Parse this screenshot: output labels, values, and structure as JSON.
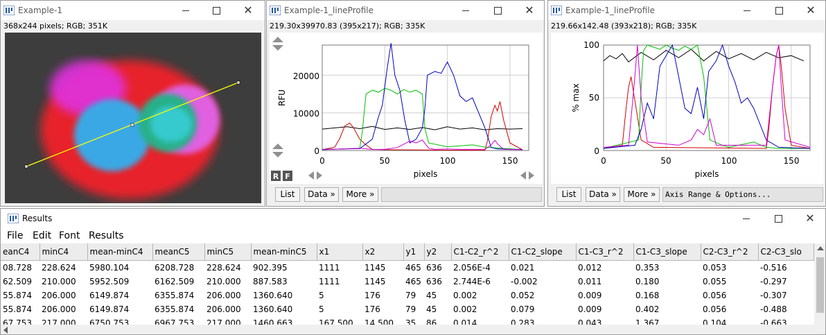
{
  "image_window": {
    "title": "Example-1",
    "info": "368x244 pixels; RGB; 351K"
  },
  "profile1": {
    "title": "Example-1_lineProfile",
    "info": "219.30x39970.83  (395x217); RGB; 335K",
    "ylabel": "RFU",
    "xlabel": "pixels",
    "y_ticks": [
      "0",
      "10000",
      "20000"
    ],
    "x_ticks": [
      "0",
      "50",
      "100",
      "150"
    ],
    "rf_r": "R",
    "rf_f": "F",
    "buttons": {
      "list": "List",
      "data": "Data »",
      "more": "More »"
    }
  },
  "profile2": {
    "title": "Example-1_lineProfile",
    "info": "219.66x142.48  (393x218); RGB; 335K",
    "ylabel": "% max",
    "xlabel": "pixels",
    "y_ticks": [
      "0",
      "50",
      "100"
    ],
    "x_ticks": [
      "0",
      "50",
      "100",
      "150"
    ],
    "buttons": {
      "list": "List",
      "data": "Data »",
      "more": "More »"
    },
    "status": "Axis Range & Options..."
  },
  "results": {
    "title": "Results",
    "menu": [
      "File",
      "Edit",
      "Font",
      "Results"
    ],
    "columns": [
      "eanC4",
      "minC4",
      "mean-minC4",
      "meanC5",
      "minC5",
      "mean-minC5",
      "x1",
      "x2",
      "y1",
      "y2",
      "C1-C2_r^2",
      "C1-C2_slope",
      "C1-C3_r^2",
      "C1-C3_slope",
      "C2-C3_r^2",
      "C2-C3_slo"
    ],
    "rows": [
      [
        "08.728",
        "228.624",
        "5980.104",
        "6208.728",
        "228.624",
        "902.395",
        "1111",
        "1145",
        "465",
        "636",
        "2.056E-4",
        "0.021",
        "0.012",
        "0.353",
        "0.053",
        "-0.516"
      ],
      [
        "62.509",
        "210.000",
        "5952.509",
        "6162.509",
        "210.000",
        "887.583",
        "1111",
        "1145",
        "465",
        "636",
        "2.744E-6",
        "-0.002",
        "0.011",
        "0.180",
        "0.055",
        "-0.297"
      ],
      [
        "55.874",
        "206.000",
        "6149.874",
        "6355.874",
        "206.000",
        "1360.640",
        "5",
        "176",
        "79",
        "45",
        "0.002",
        "0.052",
        "0.009",
        "0.168",
        "0.056",
        "-0.307"
      ],
      [
        "55.874",
        "206.000",
        "6149.874",
        "6355.874",
        "206.000",
        "1360.640",
        "5",
        "176",
        "79",
        "45",
        "0.002",
        "0.079",
        "0.009",
        "0.402",
        "0.056",
        "-0.488"
      ],
      [
        "67.753",
        "217.000",
        "6750.753",
        "6967.753",
        "217.000",
        "1460.663",
        "167.500",
        "14.500",
        "35",
        "86",
        "0.014",
        "0.283",
        "0.043",
        "1.367",
        "0.104",
        "-0.663"
      ]
    ]
  },
  "colors": {
    "channel_red": "#d00000",
    "channel_green": "#00c000",
    "channel_blue": "#0000c0",
    "channel_magenta": "#d000d0",
    "channel_black": "#000000",
    "selection_line": "#ffff00"
  },
  "chart_data": [
    {
      "type": "line",
      "title": "",
      "xlabel": "pixels",
      "ylabel": "RFU",
      "xlim": [
        0,
        165
      ],
      "ylim": [
        0,
        28000
      ],
      "grid": true,
      "series": [
        {
          "color": "#000000",
          "x": [
            0,
            10,
            20,
            30,
            40,
            50,
            60,
            70,
            80,
            90,
            100,
            110,
            120,
            130,
            140,
            150,
            160
          ],
          "y": [
            5700,
            6000,
            6300,
            5800,
            6400,
            5600,
            6000,
            5600,
            6100,
            5500,
            6300,
            5700,
            6000,
            5500,
            5800,
            5700,
            5800
          ]
        },
        {
          "color": "#d00000",
          "x": [
            0,
            10,
            14,
            18,
            22,
            25,
            30,
            35,
            40,
            50,
            100,
            130,
            132,
            135,
            138,
            140,
            142,
            145,
            150,
            160
          ],
          "y": [
            200,
            900,
            3200,
            6500,
            7300,
            6000,
            3000,
            1500,
            300,
            200,
            100,
            100,
            2500,
            9000,
            12000,
            10500,
            13000,
            8000,
            2000,
            200
          ]
        },
        {
          "color": "#00c000",
          "x": [
            0,
            30,
            32,
            35,
            40,
            45,
            50,
            55,
            60,
            65,
            70,
            75,
            80,
            82,
            85,
            100,
            120,
            130,
            160
          ],
          "y": [
            200,
            600,
            5000,
            15000,
            16000,
            15500,
            16500,
            16000,
            15000,
            16200,
            15500,
            16000,
            15000,
            6000,
            2000,
            1000,
            1500,
            900,
            200
          ]
        },
        {
          "color": "#0000c0",
          "x": [
            0,
            30,
            40,
            45,
            48,
            52,
            55,
            58,
            62,
            66,
            70,
            75,
            80,
            82,
            84,
            90,
            95,
            100,
            105,
            110,
            115,
            120,
            125,
            130,
            135,
            140,
            150,
            160
          ],
          "y": [
            300,
            500,
            3000,
            9000,
            12000,
            22000,
            28500,
            20000,
            16000,
            8000,
            2000,
            3000,
            6000,
            11000,
            20000,
            21000,
            20500,
            23500,
            20000,
            14500,
            13000,
            14000,
            10000,
            6000,
            800,
            400,
            300,
            300
          ]
        },
        {
          "color": "#d000d0",
          "x": [
            0,
            30,
            40,
            50,
            60,
            70,
            75,
            80,
            85,
            90,
            100,
            110,
            120,
            130,
            135,
            138,
            140,
            145,
            160
          ],
          "y": [
            200,
            600,
            300,
            300,
            800,
            2500,
            2000,
            2800,
            600,
            300,
            400,
            300,
            300,
            300,
            1500,
            2700,
            1800,
            300,
            200
          ]
        }
      ]
    },
    {
      "type": "line",
      "title": "",
      "xlabel": "pixels",
      "ylabel": "% max",
      "xlim": [
        0,
        165
      ],
      "ylim": [
        0,
        100
      ],
      "grid": true,
      "series": [
        {
          "color": "#000000",
          "x": [
            0,
            5,
            10,
            15,
            20,
            30,
            40,
            50,
            60,
            70,
            80,
            90,
            100,
            110,
            120,
            130,
            140,
            150,
            160
          ],
          "y": [
            85,
            90,
            87,
            92,
            84,
            93,
            86,
            95,
            88,
            96,
            85,
            94,
            87,
            92,
            86,
            93,
            88,
            90,
            85
          ]
        },
        {
          "color": "#d00000",
          "x": [
            0,
            15,
            18,
            20,
            22,
            24,
            26,
            30,
            40,
            130,
            132,
            135,
            138,
            140,
            142,
            145,
            150,
            165
          ],
          "y": [
            2,
            5,
            40,
            60,
            70,
            55,
            40,
            10,
            3,
            2,
            20,
            60,
            90,
            100,
            80,
            40,
            5,
            2
          ]
        },
        {
          "color": "#00c000",
          "x": [
            0,
            28,
            30,
            32,
            35,
            40,
            45,
            50,
            55,
            60,
            65,
            70,
            75,
            80,
            85,
            95,
            100,
            120,
            130,
            140,
            165
          ],
          "y": [
            2,
            10,
            60,
            95,
            100,
            98,
            96,
            100,
            97,
            95,
            99,
            96,
            100,
            70,
            10,
            5,
            3,
            8,
            3,
            2,
            2
          ]
        },
        {
          "color": "#0000c0",
          "x": [
            0,
            25,
            30,
            35,
            40,
            45,
            50,
            55,
            60,
            65,
            70,
            75,
            80,
            84,
            90,
            95,
            100,
            105,
            110,
            115,
            120,
            130,
            140,
            165
          ],
          "y": [
            2,
            5,
            20,
            45,
            30,
            80,
            90,
            100,
            70,
            40,
            35,
            60,
            30,
            75,
            85,
            100,
            80,
            65,
            45,
            50,
            40,
            10,
            3,
            2
          ]
        },
        {
          "color": "#d000d0",
          "x": [
            0,
            20,
            25,
            27,
            30,
            35,
            60,
            70,
            75,
            80,
            85,
            90,
            130,
            135,
            138,
            140,
            142,
            145,
            165
          ],
          "y": [
            3,
            5,
            70,
            100,
            50,
            8,
            5,
            10,
            20,
            15,
            30,
            5,
            5,
            60,
            90,
            100,
            60,
            10,
            3
          ]
        }
      ]
    }
  ]
}
